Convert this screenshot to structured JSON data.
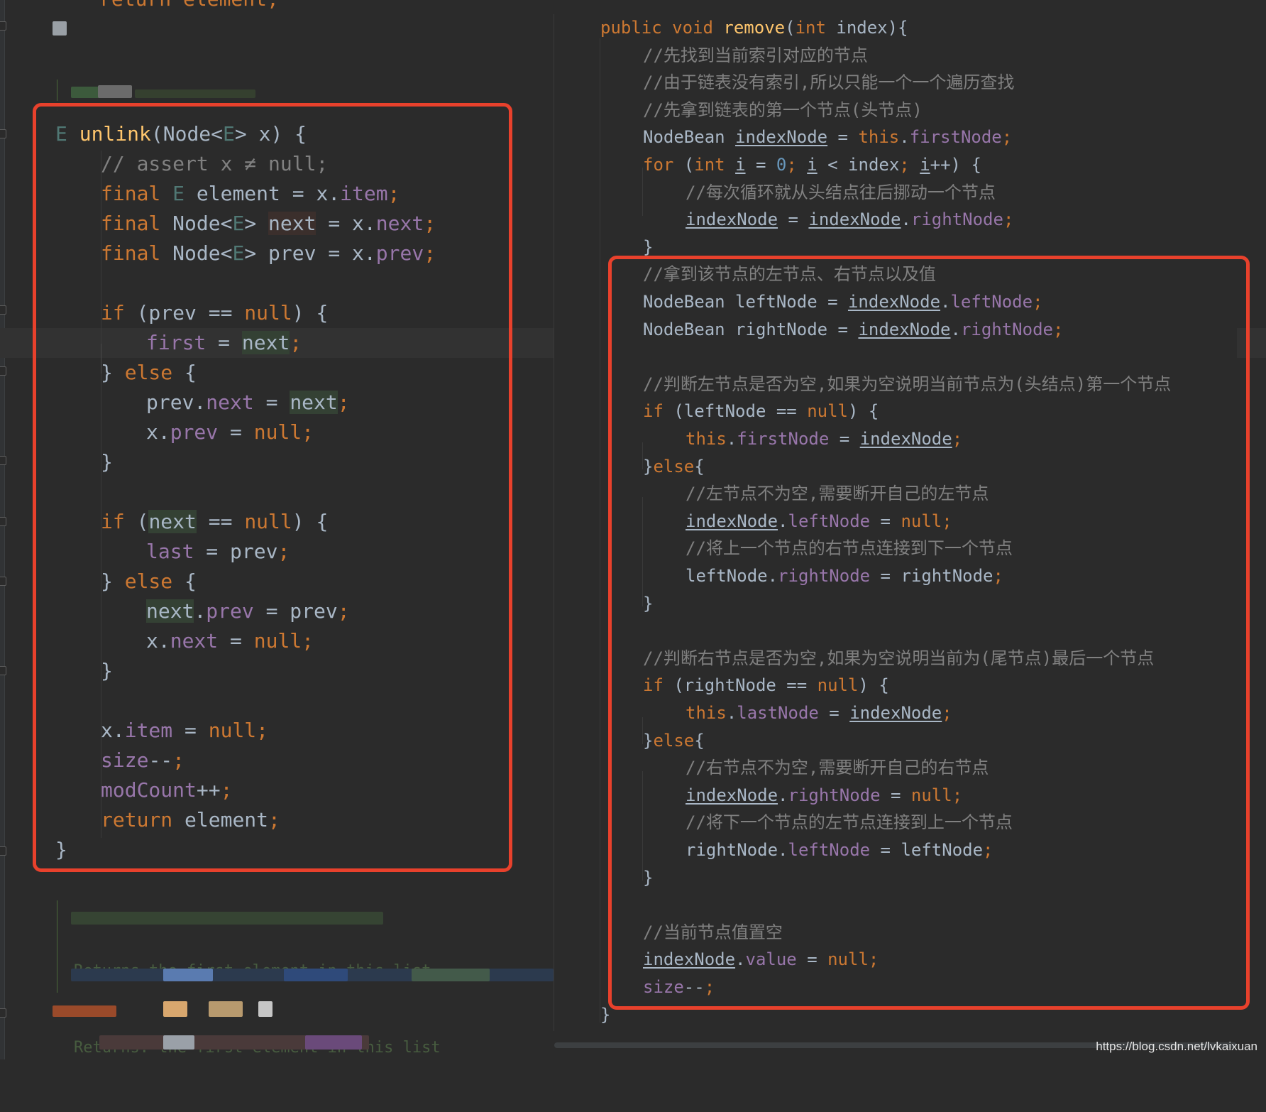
{
  "left_code": {
    "top_partial_line": "return element;",
    "lines": [
      "E unlink(Node<E> x) {",
      "// assert x ≠ null;",
      "final E element = x.item;",
      "final Node<E> next = x.next;",
      "final Node<E> prev = x.prev;",
      "",
      "if (prev == null) {",
      "first = next;",
      "} else {",
      "prev.next = next;",
      "x.prev = null;",
      "}",
      "",
      "if (next == null) {",
      "last = prev;",
      "} else {",
      "next.prev = prev;",
      "x.next = null;",
      "}",
      "",
      "x.item = null;",
      "size--;",
      "modCount++;",
      "return element;",
      "}"
    ],
    "blurred_doc": [
      "Returns the first element in this list",
      "Returns: the first element in this list"
    ]
  },
  "right_code": {
    "lines": [
      "public void remove(int index){",
      "//先找到当前索引对应的节点",
      "//由于链表没有索引,所以只能一个一个遍历查找",
      "//先拿到链表的第一个节点(头节点)",
      "NodeBean indexNode = this.firstNode;",
      "for (int i = 0; i < index; i++) {",
      "//每次循环就从头结点往后挪动一个节点",
      "indexNode = indexNode.rightNode;",
      "}",
      "//拿到该节点的左节点、右节点以及值",
      "NodeBean leftNode = indexNode.leftNode;",
      "NodeBean rightNode = indexNode.rightNode;",
      "",
      "//判断左节点是否为空,如果为空说明当前节点为(头结点)第一个节点",
      "if (leftNode == null) {",
      "this.firstNode = indexNode;",
      "}else{",
      "//左节点不为空,需要断开自己的左节点",
      "indexNode.leftNode = null;",
      "//将上一个节点的右节点连接到下一个节点",
      "leftNode.rightNode = rightNode;",
      "}",
      "",
      "//判断右节点是否为空,如果为空说明当前为(尾节点)最后一个节点",
      "if (rightNode == null) {",
      "this.lastNode = indexNode;",
      "}else{",
      "//右节点不为空,需要断开自己的右节点",
      "indexNode.rightNode = null;",
      "//将下一个节点的左节点连接到上一个节点",
      "rightNode.leftNode = leftNode;",
      "}",
      "",
      "//当前节点值置空",
      "indexNode.value = null;",
      "size--;",
      "}"
    ]
  },
  "watermark": "https://blog.csdn.net/lvkaixuan",
  "colors": {
    "background": "#2b2b2b",
    "keyword": "#cc7832",
    "method": "#ffc66d",
    "field": "#9876aa",
    "number": "#6897bb",
    "comment": "#808080",
    "highlight_box": "#e8412c"
  }
}
